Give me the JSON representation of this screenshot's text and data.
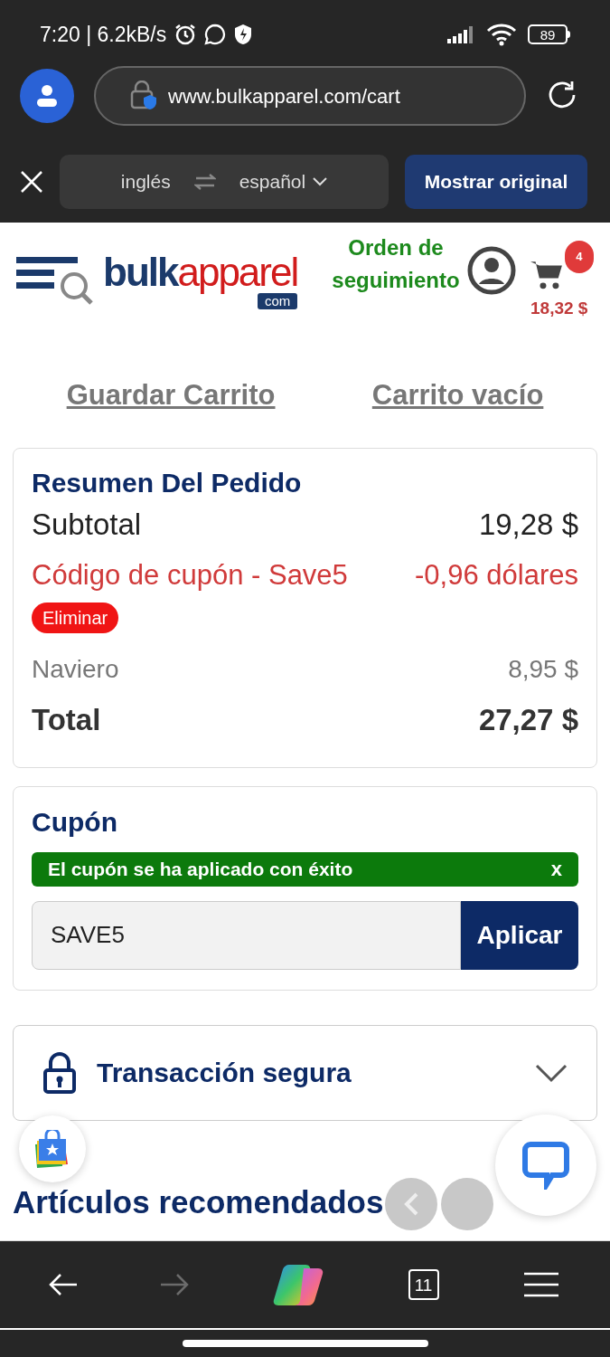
{
  "status_bar": {
    "time": "7:20 | 6.2kB/s",
    "battery": "89"
  },
  "browser": {
    "url": "www.bulkapparel.com/cart"
  },
  "translate_bar": {
    "source": "inglés",
    "target": "español",
    "show_original": "Mostrar original"
  },
  "header": {
    "logo": {
      "part_1": "bulk",
      "part_2": "apparel",
      "domain": "com"
    },
    "track_order": "Orden de seguimiento",
    "cart_count": "4",
    "cart_total": "18,32 $"
  },
  "cart_links": [
    "Guardar Carrito",
    "Carrito vacío"
  ],
  "order_summary": {
    "title": "Resumen Del Pedido",
    "lines": [
      {
        "kind": "subtotal",
        "label": "Subtotal",
        "value": "19,28 $"
      },
      {
        "kind": "discount",
        "label": "Código de cupón - Save5",
        "value": "-0,96 dólares",
        "action": "Eliminar"
      },
      {
        "kind": "muted",
        "label": "Naviero",
        "value": "8,95 $"
      },
      {
        "kind": "total",
        "label": "Total",
        "value": "27,27 $"
      }
    ]
  },
  "coupon": {
    "title": "Cupón",
    "message": "El cupón se ha aplicado con éxito",
    "dismiss": "x",
    "value": "SAVE5",
    "button": "Aplicar"
  },
  "secure_section": {
    "title": "Transacción segura",
    "expanded": false
  },
  "recommended": {
    "title": "Artículos recomendados"
  },
  "bottom_nav": [
    {
      "kind": "back",
      "disabled": false
    },
    {
      "kind": "forward",
      "disabled": true
    },
    {
      "kind": "copilot",
      "disabled": false
    },
    {
      "kind": "tabs",
      "label": "11",
      "disabled": false
    },
    {
      "kind": "menu",
      "disabled": false
    }
  ]
}
